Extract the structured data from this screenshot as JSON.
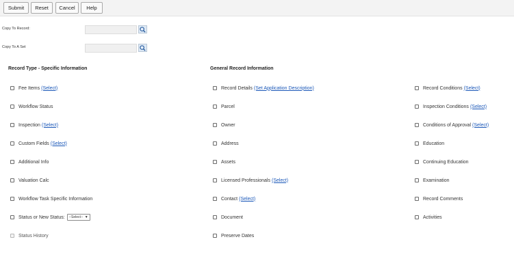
{
  "toolbar": {
    "submit": "Submit",
    "reset": "Reset",
    "cancel": "Cancel",
    "help": "Help"
  },
  "copy_to_record": {
    "label": "Copy To Record:",
    "value": "",
    "search_icon": "magnifier-icon"
  },
  "copy_to_set": {
    "label": "Copy To A Set",
    "value": "",
    "search_icon": "magnifier-icon"
  },
  "sections": {
    "left_title": "Record Type - Specific Information",
    "middle_title": "General Record Information"
  },
  "left_items": [
    {
      "label": "Fee Items",
      "link": "(Select)"
    },
    {
      "label": "Workflow Status"
    },
    {
      "label": "Inspection",
      "link": "(Select)"
    },
    {
      "label": "Custom Fields",
      "link": "(Select)"
    },
    {
      "label": "Additional Info"
    },
    {
      "label": "Valuation Calc"
    },
    {
      "label": "Workflow Task Specific Information"
    },
    {
      "label": "Status or New Status:",
      "select": "--Select--"
    },
    {
      "label": "Status History",
      "disabled": true
    }
  ],
  "middle_items": [
    {
      "label": "Record Details",
      "link": "(Set Application Description)"
    },
    {
      "label": "Parcel"
    },
    {
      "label": "Owner"
    },
    {
      "label": "Address"
    },
    {
      "label": "Assets"
    },
    {
      "label": "Licensed Professionals",
      "link": "(Select)"
    },
    {
      "label": "Contact",
      "link": "(Select)"
    },
    {
      "label": "Document"
    },
    {
      "label": "Preserve Dates"
    }
  ],
  "right_items": [
    {
      "label": "Record Conditions",
      "link": "(Select)"
    },
    {
      "label": "Inspection Conditions",
      "link": "(Select)"
    },
    {
      "label": "Conditions of Approval",
      "link": "(Select)"
    },
    {
      "label": "Education"
    },
    {
      "label": "Continuing Education"
    },
    {
      "label": "Examination"
    },
    {
      "label": "Record Comments"
    },
    {
      "label": "Activities"
    }
  ]
}
